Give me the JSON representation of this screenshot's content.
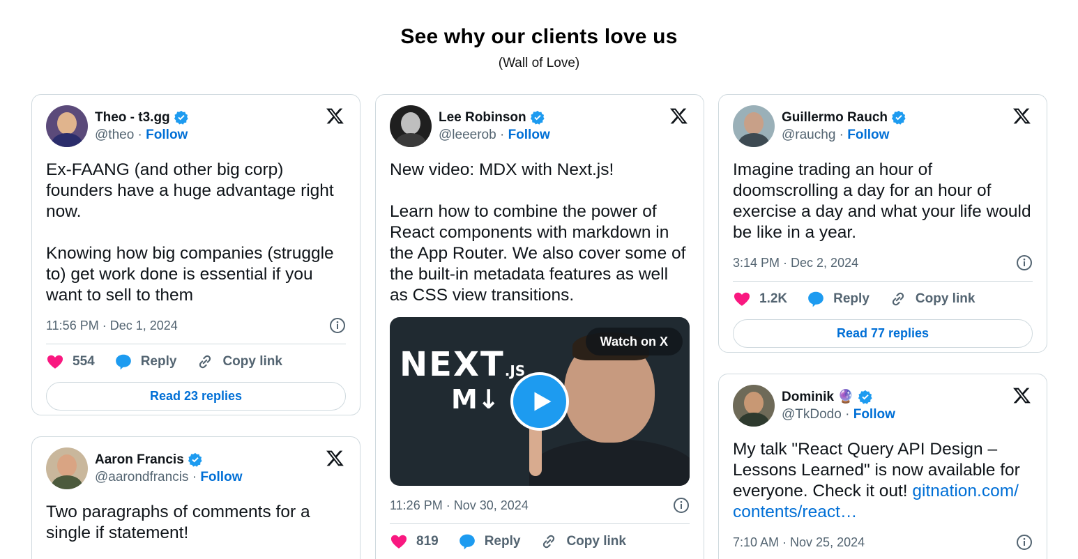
{
  "header": {
    "title": "See why our clients love us",
    "subtitle": "(Wall of Love)"
  },
  "colors": {
    "link": "#006fd6",
    "like": "#f91880",
    "reply": "#1d9bf0",
    "border": "#cfd9de",
    "muted": "#536471"
  },
  "tweets": [
    {
      "name": "Theo - t3.gg",
      "handle": "@theo",
      "follow": "Follow",
      "text": "Ex-FAANG (and other big corp) founders have a huge advantage right now.\n\nKnowing how big companies (struggle to) get work done is essential if you want to sell to them",
      "time": "11:56 PM · Dec 1, 2024",
      "likes": "554",
      "reply": "Reply",
      "copy": "Copy link",
      "read": "Read 23 replies"
    },
    {
      "name": "Aaron Francis",
      "handle": "@aarondfrancis",
      "follow": "Follow",
      "text": "Two paragraphs of comments for a single if statement!"
    },
    {
      "name": "Lee Robinson",
      "handle": "@leeerob",
      "follow": "Follow",
      "text": "New video: MDX with Next.js!\n\nLearn how to combine the power of React components with markdown in the App Router. We also cover some of the built-in metadata features as well as CSS view transitions.",
      "media": {
        "watch": "Watch on X",
        "logo_main": "NEXT",
        "logo_js": ".JS",
        "logo_mdx": "M↓"
      },
      "time": "11:26 PM · Nov 30, 2024",
      "likes": "819",
      "reply": "Reply",
      "copy": "Copy link"
    },
    {
      "name": "Guillermo Rauch",
      "handle": "@rauchg",
      "follow": "Follow",
      "text": "Imagine trading an hour of doomscrolling a day for an hour of exercise a day and what your life would be like in a year.",
      "time": "3:14 PM · Dec 2, 2024",
      "likes": "1.2K",
      "reply": "Reply",
      "copy": "Copy link",
      "read": "Read 77 replies"
    },
    {
      "name": "Dominik 🔮",
      "handle": "@TkDodo",
      "follow": "Follow",
      "text": "My talk \"React Query API Design – Lessons Learned\" is now available for everyone. Check it out! ",
      "link": "gitnation.com/\ncontents/react…",
      "time": "7:10 AM · Nov 25, 2024"
    }
  ]
}
